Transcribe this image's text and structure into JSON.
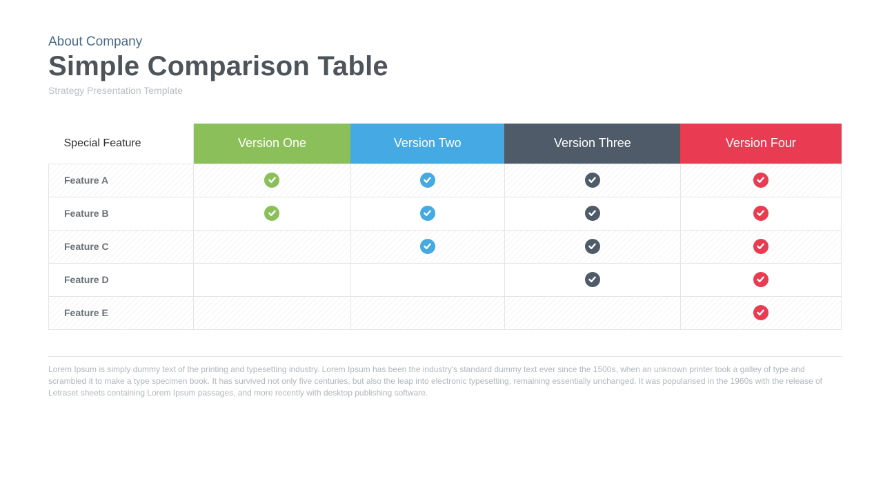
{
  "kicker": "About Company",
  "title": "Simple Comparison Table",
  "subtitle": "Strategy Presentation Template",
  "rowHeader": "Special Feature",
  "colors": {
    "green": "#8bbf5a",
    "blue": "#45a9e3",
    "slate": "#4f5b68",
    "red": "#e93b52"
  },
  "columns": [
    {
      "label": "Version One",
      "color": "green"
    },
    {
      "label": "Version Two",
      "color": "blue"
    },
    {
      "label": "Version Three",
      "color": "slate"
    },
    {
      "label": "Version Four",
      "color": "red"
    }
  ],
  "rows": [
    {
      "label": "Feature A",
      "values": [
        true,
        true,
        true,
        true
      ]
    },
    {
      "label": "Feature B",
      "values": [
        true,
        true,
        true,
        true
      ]
    },
    {
      "label": "Feature C",
      "values": [
        false,
        true,
        true,
        true
      ]
    },
    {
      "label": "Feature D",
      "values": [
        false,
        false,
        true,
        true
      ]
    },
    {
      "label": "Feature E",
      "values": [
        false,
        false,
        false,
        true
      ]
    }
  ],
  "footnote": "Lorem Ipsum is simply dummy text of the printing and typesetting industry. Lorem Ipsum has been the industry's standard dummy text ever since the 1500s, when an unknown printer took a galley of type and scrambled it to make a type specimen book. It has survived not only five centuries, but also the leap into electronic typesetting, remaining essentially unchanged. It was popularised in the 1960s with the release of Letraset sheets containing Lorem Ipsum passages, and more recently with desktop publishing software.",
  "chart_data": {
    "type": "table",
    "title": "Simple Comparison Table",
    "row_header": "Special Feature",
    "columns": [
      "Version One",
      "Version Two",
      "Version Three",
      "Version Four"
    ],
    "rows": [
      "Feature A",
      "Feature B",
      "Feature C",
      "Feature D",
      "Feature E"
    ],
    "matrix": [
      [
        true,
        true,
        true,
        true
      ],
      [
        true,
        true,
        true,
        true
      ],
      [
        false,
        true,
        true,
        true
      ],
      [
        false,
        false,
        true,
        true
      ],
      [
        false,
        false,
        false,
        true
      ]
    ]
  }
}
